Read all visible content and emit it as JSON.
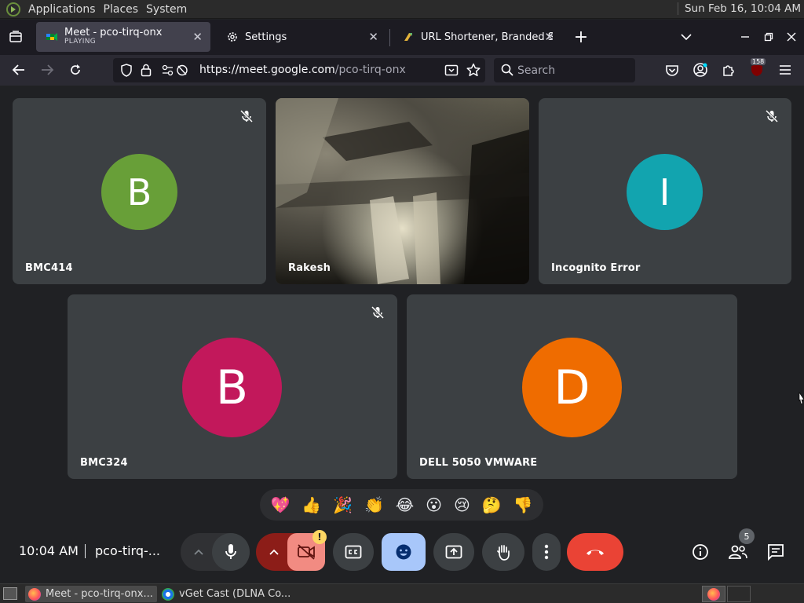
{
  "panel": {
    "menus": [
      "Applications",
      "Places",
      "System"
    ],
    "clock": "Sun Feb 16, 10:04 AM"
  },
  "tabs": [
    {
      "title": "Meet - pco-tirq-onx",
      "subtitle": "PLAYING"
    },
    {
      "title": "Settings"
    },
    {
      "title": "URL Shortener, Branded Sh"
    }
  ],
  "nav": {
    "url_host": "https://meet.google.com",
    "url_path": "/pco-tirq-onx",
    "search_placeholder": "Search",
    "badge_count": "158"
  },
  "tiles": [
    {
      "name": "BMC414",
      "initial": "B",
      "color": "#689f38",
      "muted": true
    },
    {
      "name": "Rakesh",
      "video": true,
      "muted": false
    },
    {
      "name": "Incognito Error",
      "initial": "I",
      "color": "#12a4af",
      "muted": true
    },
    {
      "name": "BMC324",
      "initial": "B",
      "color": "#c2185b",
      "muted": true
    },
    {
      "name": "DELL 5050 VMWARE",
      "initial": "D",
      "color": "#ef6c00",
      "muted": false
    }
  ],
  "reactions": [
    "💖",
    "👍",
    "🎉",
    "👏",
    "😂",
    "😮",
    "😢",
    "🤔",
    "👎"
  ],
  "controls": {
    "time": "10:04 AM",
    "meeting_code": "pco-tirq-...",
    "people_count": "5",
    "camera_warning": "!"
  },
  "colors": {
    "hangup": "#ea4335",
    "camera_off_bg": "#f28b82",
    "reaction_active_bg": "#a8c7fa",
    "mic_more_bg": "#8c1d18"
  },
  "taskbar": {
    "items": [
      "Meet - pco-tirq-onx...",
      "vGet Cast (DLNA Co..."
    ]
  }
}
